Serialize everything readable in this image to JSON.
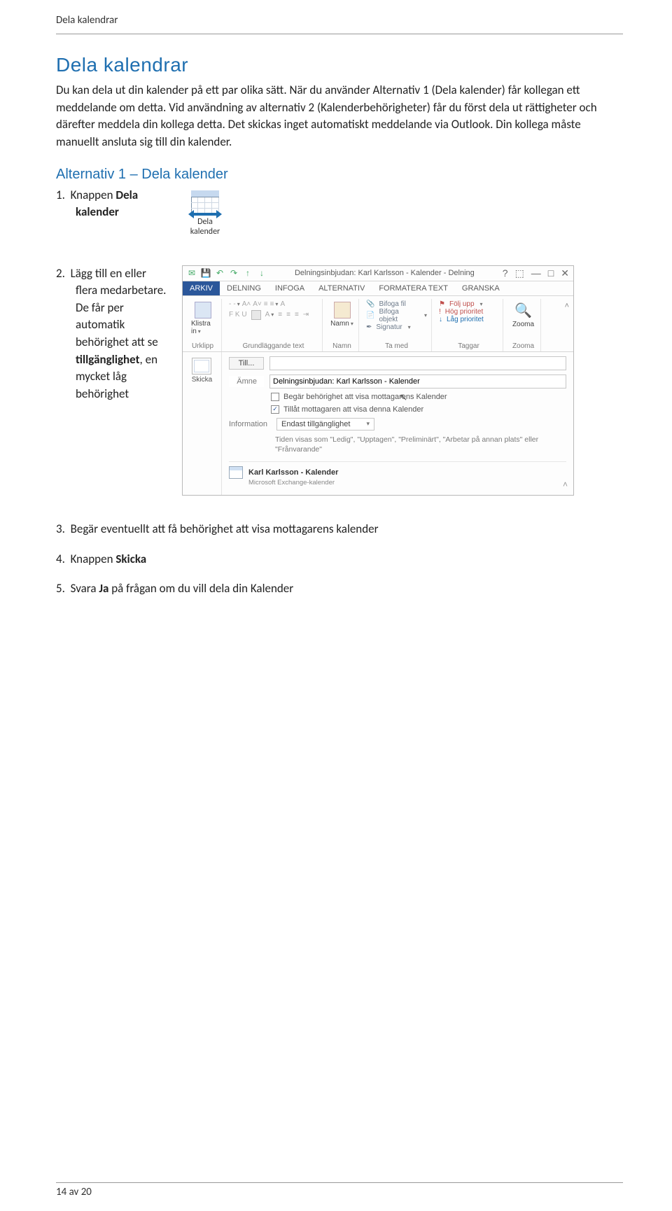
{
  "header": {
    "label": "Dela kalendrar"
  },
  "title": "Dela kalendrar",
  "intro": "Du kan dela ut din kalender på ett par olika sätt. När du använder Alternativ 1 (Dela kalender) får kollegan ett meddelande om detta. Vid användning av alternativ 2 (Kalenderbehörigheter) får du först dela ut rättigheter och därefter meddela din kollega detta. Det skickas inget automatiskt meddelande via Outlook. Din kollega måste manuellt ansluta sig till din kalender.",
  "alt1_heading": "Alternativ 1 – Dela kalender",
  "step1": {
    "num": "1.",
    "text_a": "Knappen ",
    "bold": "Dela kalender"
  },
  "share_button_label": "Dela kalender",
  "step2": {
    "num": "2.",
    "text_a": "Lägg till en eller flera medarbetare. De får per automatik behörighet att se ",
    "bold": "tillgänglighet",
    "text_b": ", en mycket låg behörighet"
  },
  "outlook": {
    "qat": {
      "icon1": "✉",
      "icon2": "💾",
      "icon3": "↶",
      "icon4": "↷",
      "icon5": "↑",
      "icon6": "↓"
    },
    "title": "Delningsinbjudan: Karl Karlsson - Kalender - Delning",
    "help": "?",
    "expand": "⬚",
    "min": "—",
    "restore": "□",
    "close": "✕",
    "tabs": [
      "ARKIV",
      "DELNING",
      "INFOGA",
      "ALTERNATIV",
      "FORMATERA TEXT",
      "GRANSKA"
    ],
    "ribbon": {
      "group1": {
        "big1": "Klistra in",
        "label": "Urklipp"
      },
      "group2": {
        "row1": "F  K  U",
        "label": "Grundläggande text"
      },
      "group3": {
        "big1": "Namn",
        "label": "Namn"
      },
      "group4": {
        "r1": "Bifoga fil",
        "r2": "Bifoga objekt",
        "r3": "Signatur",
        "label": "Ta med"
      },
      "group5": {
        "r1": "Följ upp",
        "r2": "Hög prioritet",
        "r3": "Låg prioritet",
        "label": "Taggar"
      },
      "group6": {
        "big1": "Zooma",
        "label": "Zooma"
      }
    },
    "left": {
      "btn1": "Skicka"
    },
    "fields": {
      "to_label": "Till...",
      "to_value": "",
      "subject_label": "Ämne",
      "subject_value": "Delningsinbjudan: Karl Karlsson - Kalender",
      "cb1": "Begär behörighet att visa mottagarens Kalender",
      "cb2_checked": true,
      "cb2": "Tillåt mottagaren att visa denna Kalender",
      "info_label": "Information",
      "select_value": "Endast tillgänglighet",
      "hint": "Tiden visas som \"Ledig\", \"Upptagen\", \"Preliminärt\", \"Arbetar på annan plats\" eller \"Frånvarande\"",
      "cal_name": "Karl Karlsson - Kalender",
      "cal_sub": "Microsoft Exchange-kalender"
    }
  },
  "step3": {
    "num": "3.",
    "text": "Begär eventuellt att få behörighet att visa mottagarens kalender"
  },
  "step4": {
    "num": "4.",
    "text_a": "Knappen ",
    "bold": "Skicka"
  },
  "step5": {
    "num": "5.",
    "text_a": "Svara ",
    "bold": "Ja",
    "text_b": " på frågan om du vill dela din Kalender"
  },
  "footer": "14 av 20"
}
